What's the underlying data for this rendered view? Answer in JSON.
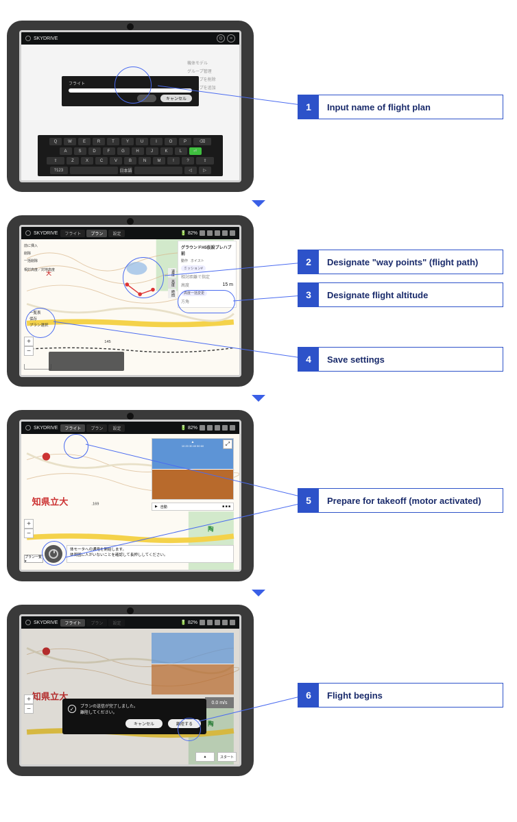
{
  "app_name": "SKYDRIVE",
  "steps": [
    {
      "num": "1",
      "label": "Input name of flight plan"
    },
    {
      "num": "2",
      "label": "Designate \"way points\" (flight path)"
    },
    {
      "num": "3",
      "label": "Designate flight altitude"
    },
    {
      "num": "4",
      "label": "Save settings"
    },
    {
      "num": "5",
      "label": "Prepare for takeoff (motor activated)"
    },
    {
      "num": "6",
      "label": "Flight begins"
    }
  ],
  "screen1": {
    "side_items": [
      "機体モデル",
      "グループ管理",
      "グループを削除",
      "グループを追加"
    ],
    "dialog_label": "フライト",
    "dialog_save": "キャンセル",
    "keyboard_rows": [
      [
        "Q",
        "W",
        "E",
        "R",
        "T",
        "Y",
        "U",
        "I",
        "O",
        "P",
        "⌫"
      ],
      [
        "A",
        "S",
        "D",
        "F",
        "G",
        "H",
        "J",
        "K",
        "L",
        "⏎"
      ],
      [
        "⇧",
        "Z",
        "X",
        "C",
        "V",
        "B",
        "N",
        "M",
        "!",
        "?",
        "⇧"
      ],
      [
        "?123",
        "",
        "日本語",
        "",
        "◁",
        "▷"
      ]
    ]
  },
  "screen2": {
    "tabs": [
      "フライト",
      "プラン",
      "設定"
    ],
    "active_tab": "プラン",
    "battery": "82%",
    "left_controls": [
      "前に挿入",
      "削除",
      "一括削除",
      "相対高度／対地高度"
    ],
    "left_lower": [
      "一覧表",
      "保存",
      "プラン選択"
    ],
    "panel_title": "グラウンドH5仮設プレハブ前",
    "panel_sub": [
      "動作",
      "ホイスト"
    ],
    "panel_mission": "ミッション#",
    "panel_disabled": "相対距離で指定",
    "panel_rows": [
      {
        "label": "高度",
        "value": "15 m"
      },
      {
        "label": "",
        "value": "高度一括変更"
      },
      {
        "label": "方角",
        "value": ""
      }
    ],
    "vtabs": [
      "速度",
      "高度",
      "時間"
    ],
    "scale": "145"
  },
  "screen3": {
    "tabs": [
      "フライト",
      "プラン",
      "設定"
    ],
    "active_tab": "フライト",
    "battery": "82%",
    "big_label": "知県立大",
    "elev": "169",
    "green_label": "陶",
    "mode_label": "自動",
    "msg_line1": "体モータへの通電を開始します。",
    "msg_line2": "体周囲に人がいないことを確認して長押ししてください。",
    "dropdown": "プラン一覧 ▾",
    "adi_top": "▲"
  },
  "screen4": {
    "tabs": [
      "フライト",
      "プラン",
      "設定"
    ],
    "active_tab": "フライト",
    "battery": "82%",
    "big_label": "知県立大",
    "green_label": "陶",
    "speed": "0.0 m/s",
    "modal_text1": "プランの送信が完了しました。",
    "modal_text2": "離陸してください。",
    "modal_cancel": "キャンセル",
    "modal_go": "離陸する",
    "bottom_buttons": [
      "▲",
      "スタート"
    ]
  }
}
